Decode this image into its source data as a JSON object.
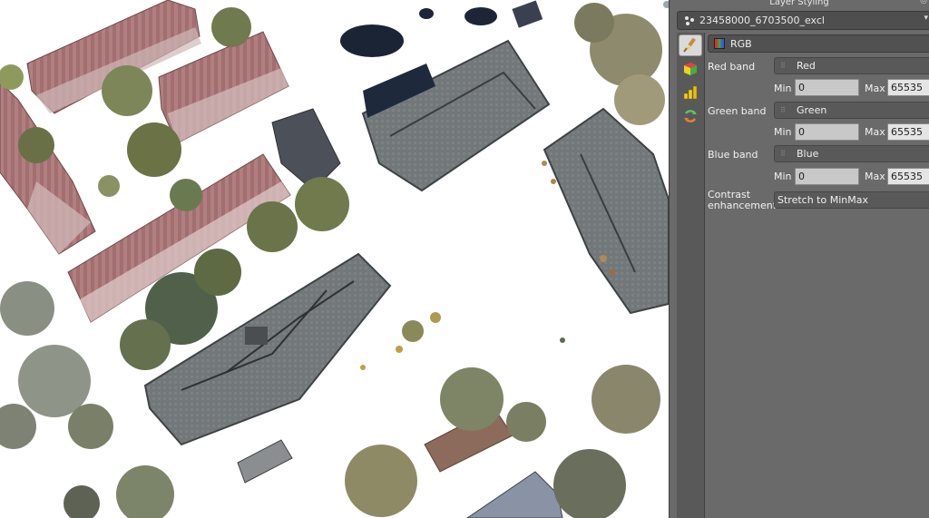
{
  "panel": {
    "title": "Layer Styling",
    "layer_name": "23458000_6703500_excl",
    "renderer": "RGB",
    "bands": [
      {
        "label": "Red band",
        "value": "Red",
        "min_label": "Min",
        "min": "0",
        "max_label": "Max",
        "max": "65535"
      },
      {
        "label": "Green band",
        "value": "Green",
        "min_label": "Min",
        "min": "0",
        "max_label": "Max",
        "max": "65535"
      },
      {
        "label": "Blue band",
        "value": "Blue",
        "min_label": "Min",
        "min": "0",
        "max_label": "Max",
        "max": "65535"
      }
    ],
    "contrast": {
      "label_line1": "Contrast",
      "label_line2": "enhancement",
      "value": "Stretch to MinMax"
    },
    "tabs": [
      "paintbrush-icon",
      "3d-cube-icon",
      "histogram-icon",
      "history-icon"
    ]
  },
  "colors": {
    "panel_bg": "#6a6a6a",
    "map_bg": "#ffffff",
    "roof_red": "#9c6a6c",
    "roof_gray": "#6f7375",
    "tree_green": "#7e8a55"
  }
}
